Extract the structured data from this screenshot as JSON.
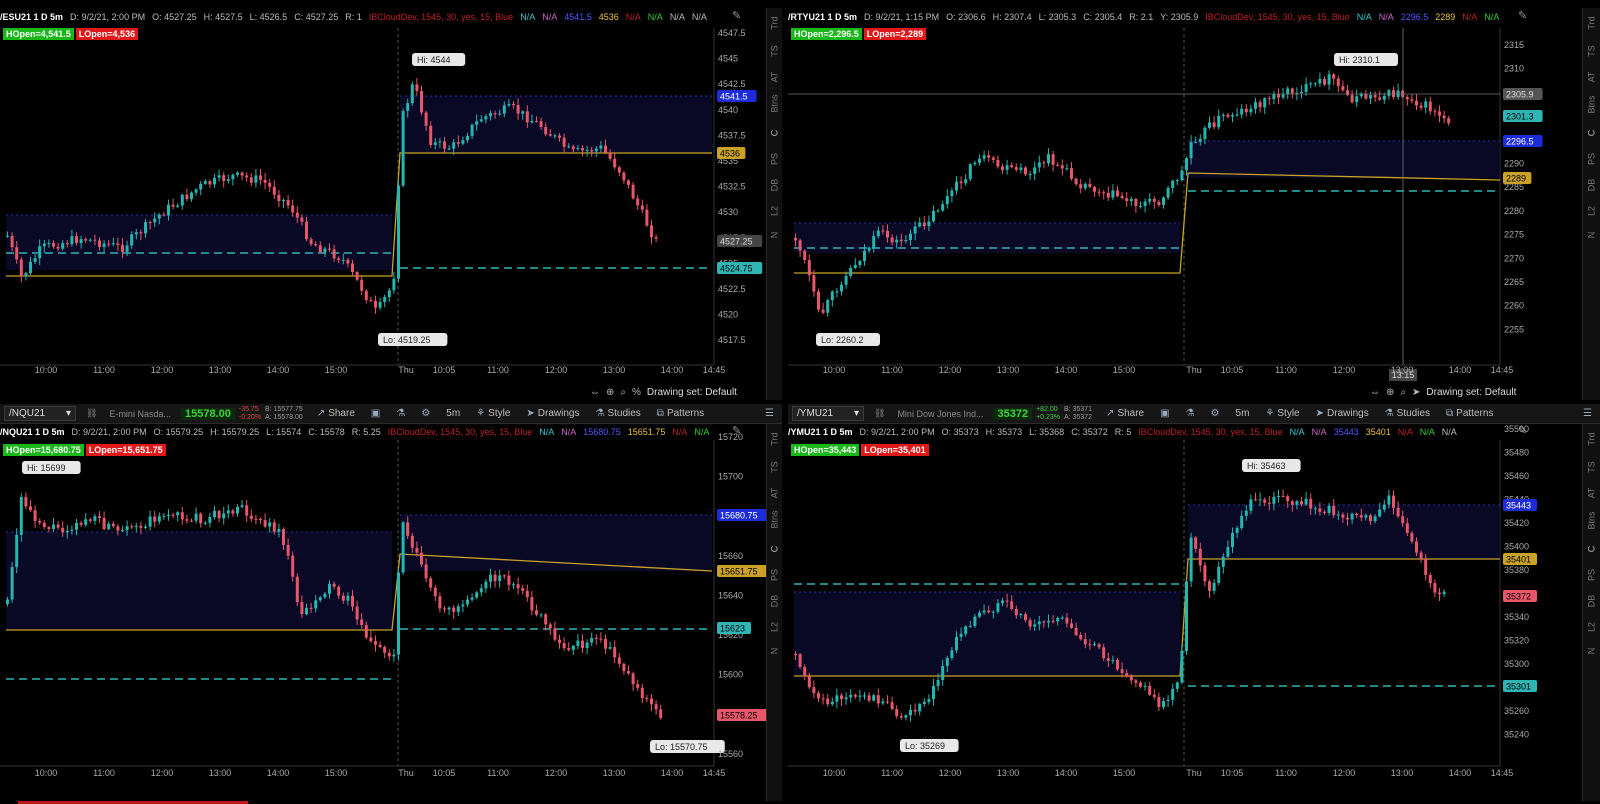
{
  "colors": {
    "bull": "#26b6b0",
    "bear": "#e8566a",
    "hopen": "#1d2cd8",
    "lopen": "#c9a227",
    "dash_cyan": "#2fb5b5",
    "bg": "#000000"
  },
  "sidebar_items": [
    "Trd",
    "TS",
    "AT",
    "Btns",
    "C",
    "PS",
    "DB",
    "L2",
    "N"
  ],
  "statusbar": {
    "drawing_set": "Drawing set: Default",
    "percent": "%"
  },
  "toolbars": [
    {
      "symbol": "/NQU21",
      "description": "E-mini Nasda...",
      "last": "15578.00",
      "change_top": "-35.75",
      "change_bot": "-0.20%",
      "bid": "B: 15577.75",
      "ask": "A: 15578.00",
      "share": "Share",
      "interval": "5m",
      "style": "Style",
      "drawings": "Drawings",
      "studies": "Studies",
      "patterns": "Patterns"
    },
    {
      "symbol": "/YMU21",
      "description": "Mini Dow Jones Ind...",
      "last": "35372",
      "change_top": "+82.00",
      "change_bot": "+0.23%",
      "bid": "B: 35371",
      "ask": "A: 35372",
      "share": "Share",
      "interval": "5m",
      "style": "Style",
      "drawings": "Drawings",
      "studies": "Studies",
      "patterns": "Patterns"
    }
  ],
  "charts": [
    {
      "header": {
        "symbol": "/ESU21 1 D 5m",
        "date": "D: 9/2/21, 2:00 PM",
        "open": "O: 4527.25",
        "high": "H: 4527.5",
        "low": "L: 4526.5",
        "close": "C: 4527.25",
        "extra": "R: 1",
        "study": "IBCloudDev, 1545, 30, yes, 15, Blue",
        "vals": [
          "N/A",
          "N/A",
          "4541.5",
          "4536",
          "N/A",
          "N/A",
          "N/A",
          "N/A"
        ]
      },
      "hopen": "HOpen=4,541.5",
      "lopen": "LOpen=4,536",
      "hi_label": "Hi: 4544",
      "lo_label": "Lo: 4519.25",
      "price_labels": [
        "4541.5",
        "4536",
        "4527.25",
        "4524.75"
      ],
      "yticks": [
        "4547.5",
        "4545",
        "4542.5",
        "4540",
        "4537.5",
        "4535",
        "4532.5",
        "4530",
        "4527.5",
        "4525",
        "4522.5",
        "4520",
        "4517.5"
      ],
      "xticks": [
        "10:00",
        "11:00",
        "12:00",
        "13:00",
        "14:00",
        "15:00",
        "Thu",
        "10:05",
        "11:00",
        "12:00",
        "13:00",
        "14:00",
        "14:45"
      ]
    },
    {
      "header": {
        "symbol": "/RTYU21 1 D 5m",
        "date": "D: 9/2/21, 1:15 PM",
        "open": "O: 2306.6",
        "high": "H: 2307.4",
        "low": "L: 2305.3",
        "close": "C: 2305.4",
        "extra": "R: 2.1",
        "extra2": "Y: 2305.9",
        "study": "IBCloudDev, 1545, 30, yes, 15, Blue",
        "vals": [
          "N/A",
          "N/A",
          "2296.5",
          "2289",
          "N/A",
          "N/A"
        ]
      },
      "hopen": "HOpen=2,296.5",
      "lopen": "LOpen=2,289",
      "hi_label": "Hi: 2310.1",
      "lo_label": "Lo: 2260.2",
      "price_labels": [
        "2305.9",
        "2301.3",
        "2296.5",
        "2289"
      ],
      "crosshair_time": "13:15",
      "yticks": [
        "2315",
        "2310",
        "2305",
        "2300",
        "2295",
        "2290",
        "2285",
        "2280",
        "2275",
        "2270",
        "2265",
        "2260",
        "2255"
      ],
      "xticks": [
        "10:00",
        "11:00",
        "12:00",
        "13:00",
        "14:00",
        "15:00",
        "Thu",
        "10:05",
        "11:00",
        "12:00",
        "13:00",
        "14:00",
        "14:45"
      ]
    },
    {
      "header": {
        "symbol": "/NQU21 1 D 5m",
        "date": "D: 9/2/21, 2:00 PM",
        "open": "O: 15579.25",
        "high": "H: 15579.25",
        "low": "L: 15574",
        "close": "C: 15578",
        "extra": "R: 5.25",
        "study": "IBCloudDev, 1545, 30, yes, 15, Blue",
        "vals": [
          "N/A",
          "N/A",
          "15680.75",
          "15651.75",
          "N/A",
          "N/A"
        ]
      },
      "hopen": "HOpen=15,680.75",
      "lopen": "LOpen=15,651.75",
      "hi_label": "Hi: 15699",
      "lo_label": "Lo: 15570.75",
      "price_labels": [
        "15680.75",
        "15651.75",
        "15623",
        "15578.25"
      ],
      "yticks": [
        "15720",
        "15700",
        "15680",
        "15660",
        "15640",
        "15620",
        "15600",
        "15580",
        "15560"
      ],
      "xticks": [
        "10:00",
        "11:00",
        "12:00",
        "13:00",
        "14:00",
        "15:00",
        "Thu",
        "10:05",
        "11:00",
        "12:00",
        "13:00",
        "14:00",
        "14:45"
      ]
    },
    {
      "header": {
        "symbol": "/YMU21 1 D 5m",
        "date": "D: 9/2/21, 2:00 PM",
        "open": "O: 35373",
        "high": "H: 35373",
        "low": "L: 35368",
        "close": "C: 35372",
        "extra": "R: 5",
        "study": "IBCloudDev, 1545, 30, yes, 15, Blue",
        "vals": [
          "N/A",
          "N/A",
          "35443",
          "35401",
          "N/A",
          "N/A",
          "N/A"
        ]
      },
      "hopen": "HOpen=35,443",
      "lopen": "LOpen=35,401",
      "hi_label": "Hi: 35463",
      "lo_label": "Lo: 35269",
      "price_labels": [
        "35443",
        "35401",
        "35372",
        "35301"
      ],
      "yticks": [
        "35500",
        "35480",
        "35460",
        "35440",
        "35420",
        "35400",
        "35380",
        "35360",
        "35340",
        "35320",
        "35300",
        "35280",
        "35260",
        "35240"
      ],
      "xticks": [
        "10:00",
        "11:00",
        "12:00",
        "13:00",
        "14:00",
        "15:00",
        "Thu",
        "10:05",
        "11:00",
        "12:00",
        "13:00",
        "14:00",
        "14:45"
      ]
    }
  ]
}
